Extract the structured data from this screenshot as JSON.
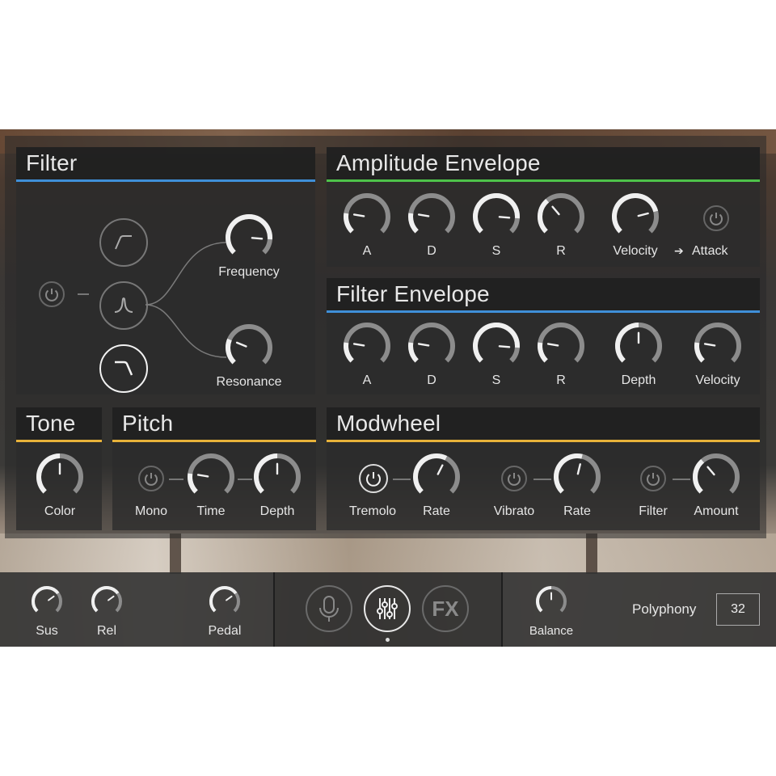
{
  "colors": {
    "filter_accent": "#3f8fd8",
    "amp_accent": "#4ec24a",
    "tone_accent": "#e8b23a",
    "knob_track": "#8c8c8c",
    "knob_value": "#f0f0f0"
  },
  "filter": {
    "title": "Filter",
    "types": [
      {
        "icon": "highpass-icon",
        "selected": false
      },
      {
        "icon": "bandpass-icon",
        "selected": false
      },
      {
        "icon": "lowpass-icon",
        "selected": true
      }
    ],
    "knobs": [
      {
        "label": "Frequency",
        "value": 0.85
      },
      {
        "label": "Resonance",
        "value": 0.25
      }
    ]
  },
  "amp_env": {
    "title": "Amplitude Envelope",
    "knobs": [
      {
        "label": "A",
        "value": 0.2
      },
      {
        "label": "D",
        "value": 0.2
      },
      {
        "label": "S",
        "value": 0.85
      },
      {
        "label": "R",
        "value": 0.35
      },
      {
        "label": "Velocity",
        "value": 0.78
      }
    ],
    "attack_label": "Attack",
    "arrow": "➔"
  },
  "filter_env": {
    "title": "Filter Envelope",
    "knobs": [
      {
        "label": "A",
        "value": 0.2
      },
      {
        "label": "D",
        "value": 0.2
      },
      {
        "label": "S",
        "value": 0.85
      },
      {
        "label": "R",
        "value": 0.2
      },
      {
        "label": "Depth",
        "value": 0.5
      },
      {
        "label": "Velocity",
        "value": 0.2
      }
    ]
  },
  "tone": {
    "title": "Tone",
    "knobs": [
      {
        "label": "Color",
        "value": 0.5
      }
    ]
  },
  "pitch": {
    "title": "Pitch",
    "mono_label": "Mono",
    "knobs": [
      {
        "label": "Time",
        "value": 0.2
      },
      {
        "label": "Depth",
        "value": 0.5
      }
    ]
  },
  "modwheel": {
    "title": "Modwheel",
    "tremolo_label": "Tremolo",
    "vibrato_label": "Vibrato",
    "filter_label": "Filter",
    "knobs": [
      {
        "label": "Rate",
        "value": 0.6
      },
      {
        "label": "Rate",
        "value": 0.55
      },
      {
        "label": "Amount",
        "value": 0.35
      }
    ]
  },
  "bottom": {
    "sus_label": "Sus",
    "rel_label": "Rel",
    "pedal_label": "Pedal",
    "sus_value": 0.7,
    "rel_value": 0.7,
    "pedal_value": 0.7,
    "nav": [
      {
        "icon": "microphone-icon",
        "label": ""
      },
      {
        "icon": "sliders-icon",
        "label": ""
      },
      {
        "icon": "fx-icon",
        "label": "FX"
      }
    ],
    "balance_label": "Balance",
    "balance_value": 0.5,
    "polyphony_label": "Polyphony",
    "polyphony_value": "32"
  }
}
